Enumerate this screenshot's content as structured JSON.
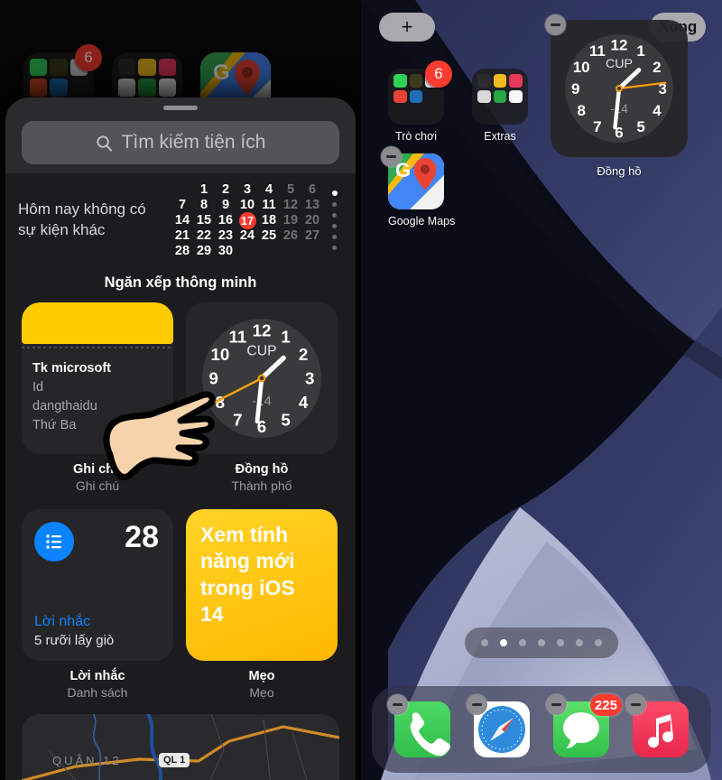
{
  "left_panel": {
    "background_folders": [
      {
        "name": "games-folder",
        "badge": "6"
      },
      {
        "name": "extras-folder",
        "badge": ""
      },
      {
        "name": "google-maps-icon",
        "badge": ""
      }
    ],
    "search": {
      "placeholder": "Tìm kiếm tiện ích",
      "icon": "search-icon"
    },
    "calendar_widget": {
      "message_line1": "Hôm nay không có",
      "message_line2": "sự kiện khác",
      "days": [
        {
          "d": "",
          "style": "blank"
        },
        {
          "d": "1",
          "style": "normal"
        },
        {
          "d": "2",
          "style": "normal"
        },
        {
          "d": "3",
          "style": "normal"
        },
        {
          "d": "4",
          "style": "normal"
        },
        {
          "d": "5",
          "style": "dim"
        },
        {
          "d": "6",
          "style": "dim"
        },
        {
          "d": "7",
          "style": "normal"
        },
        {
          "d": "8",
          "style": "normal"
        },
        {
          "d": "9",
          "style": "normal"
        },
        {
          "d": "10",
          "style": "normal"
        },
        {
          "d": "11",
          "style": "normal"
        },
        {
          "d": "12",
          "style": "dim"
        },
        {
          "d": "13",
          "style": "dim"
        },
        {
          "d": "14",
          "style": "normal"
        },
        {
          "d": "15",
          "style": "normal"
        },
        {
          "d": "16",
          "style": "normal"
        },
        {
          "d": "17",
          "style": "today"
        },
        {
          "d": "18",
          "style": "normal"
        },
        {
          "d": "19",
          "style": "dim"
        },
        {
          "d": "20",
          "style": "dim"
        },
        {
          "d": "21",
          "style": "normal"
        },
        {
          "d": "22",
          "style": "normal"
        },
        {
          "d": "23",
          "style": "normal"
        },
        {
          "d": "24",
          "style": "normal"
        },
        {
          "d": "25",
          "style": "normal"
        },
        {
          "d": "26",
          "style": "dim"
        },
        {
          "d": "27",
          "style": "dim"
        },
        {
          "d": "28",
          "style": "normal"
        },
        {
          "d": "29",
          "style": "normal"
        },
        {
          "d": "30",
          "style": "normal"
        },
        {
          "d": "",
          "style": "blank"
        },
        {
          "d": "",
          "style": "blank"
        },
        {
          "d": "",
          "style": "blank"
        },
        {
          "d": "",
          "style": "blank"
        }
      ],
      "page_dots": 6,
      "active_dot": 0
    },
    "section_title": "Ngăn xếp thông minh",
    "widgets": [
      {
        "id": "notes",
        "name": "Ghi chú",
        "subtitle": "Ghi chú",
        "note_title": "Tk microsoft",
        "note_line1": "Id",
        "note_line2": "dangthaidu",
        "note_line3": "Thứ Ba",
        "accent": "#ffcc00"
      },
      {
        "id": "clock",
        "name": "Đồng hồ",
        "subtitle": "Thành phố",
        "city": "CUP",
        "temperature": "-14",
        "hour_deg": 47,
        "minute_deg": 186,
        "second_deg": 243,
        "hand_color": "#ffffff",
        "second_color": "#ff9f0a",
        "numerals": [
          "12",
          "1",
          "2",
          "3",
          "4",
          "5",
          "6",
          "7",
          "8",
          "9",
          "10",
          "11"
        ]
      },
      {
        "id": "reminders",
        "name": "Lời nhắc",
        "subtitle": "Danh sách",
        "count": "28",
        "list_name": "Lời nhắc",
        "item": "5 rưỡi lấy giò",
        "accent": "#0a84ff"
      },
      {
        "id": "tips",
        "name": "Mẹo",
        "subtitle": "Mẹo",
        "headline": "Xem tính năng mới trong iOS 14",
        "accent": "#ffcc00"
      }
    ],
    "maps_peek": {
      "district": "QUẬN 12",
      "road": "QL 1"
    }
  },
  "right_panel": {
    "add_button": "+",
    "done_button": "Xong",
    "apps": [
      {
        "id": "games-folder",
        "label": "Trò chơi",
        "badge": "6",
        "type": "folder",
        "remove": false
      },
      {
        "id": "extras-folder",
        "label": "Extras",
        "badge": "",
        "type": "folder",
        "remove": false
      },
      {
        "id": "google-maps",
        "label": "Google Maps",
        "badge": "",
        "type": "app",
        "remove": true
      }
    ],
    "clock_widget": {
      "label": "Đồng hồ",
      "city": "CUP",
      "temperature": "-14",
      "hour_deg": 47,
      "minute_deg": 186,
      "second_deg": 83,
      "remove": true
    },
    "page_dots": 7,
    "active_dot": 1,
    "dock": [
      {
        "id": "phone",
        "label": "Phone",
        "badge": "",
        "remove": true
      },
      {
        "id": "safari",
        "label": "Safari",
        "badge": "",
        "remove": true
      },
      {
        "id": "messages",
        "label": "Messages",
        "badge": "225",
        "remove": true
      },
      {
        "id": "music",
        "label": "Music",
        "badge": "",
        "remove": true
      }
    ]
  },
  "cursor": {
    "type": "pointing-hand-cursor"
  }
}
